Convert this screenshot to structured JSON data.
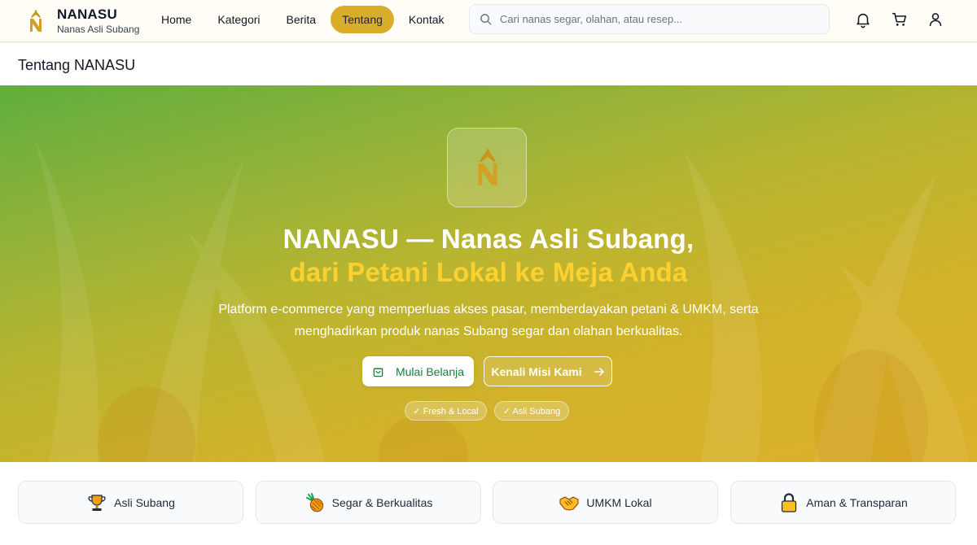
{
  "brand": {
    "name": "NANASU",
    "tagline": "Nanas Asli Subang"
  },
  "nav": {
    "items": [
      {
        "label": "Home",
        "active": false
      },
      {
        "label": "Kategori",
        "active": false
      },
      {
        "label": "Berita",
        "active": false
      },
      {
        "label": "Tentang",
        "active": true
      },
      {
        "label": "Kontak",
        "active": false
      }
    ]
  },
  "search": {
    "placeholder": "Cari nanas segar, olahan, atau resep...",
    "value": ""
  },
  "header_icons": [
    "bell-icon",
    "cart-icon",
    "user-icon"
  ],
  "page": {
    "title": "Tentang NANASU"
  },
  "hero": {
    "title_line1": "NANASU — Nanas Asli Subang,",
    "title_line2": "dari Petani Lokal ke Meja Anda",
    "description": "Platform e-commerce yang memperluas akses pasar, memberdayakan petani & UMKM, serta menghadirkan produk nanas Subang segar dan olahan berkualitas.",
    "primary_button": "Mulai Belanja",
    "secondary_button": "Kenali Misi Kami",
    "badges": [
      "✓ Fresh & Local",
      "✓ Asli Subang"
    ]
  },
  "features": [
    {
      "icon": "trophy-icon",
      "label": "Asli Subang"
    },
    {
      "icon": "pineapple-icon",
      "label": "Segar & Berkualitas"
    },
    {
      "icon": "handshake-icon",
      "label": "UMKM Lokal"
    },
    {
      "icon": "lock-icon",
      "label": "Aman & Transparan"
    }
  ],
  "colors": {
    "accent": "#d8ad2a",
    "highlight": "#fbd130",
    "primary_green": "#15803d",
    "hero_gradient_start": "#5fae3c",
    "hero_gradient_end": "#dcb02a"
  }
}
